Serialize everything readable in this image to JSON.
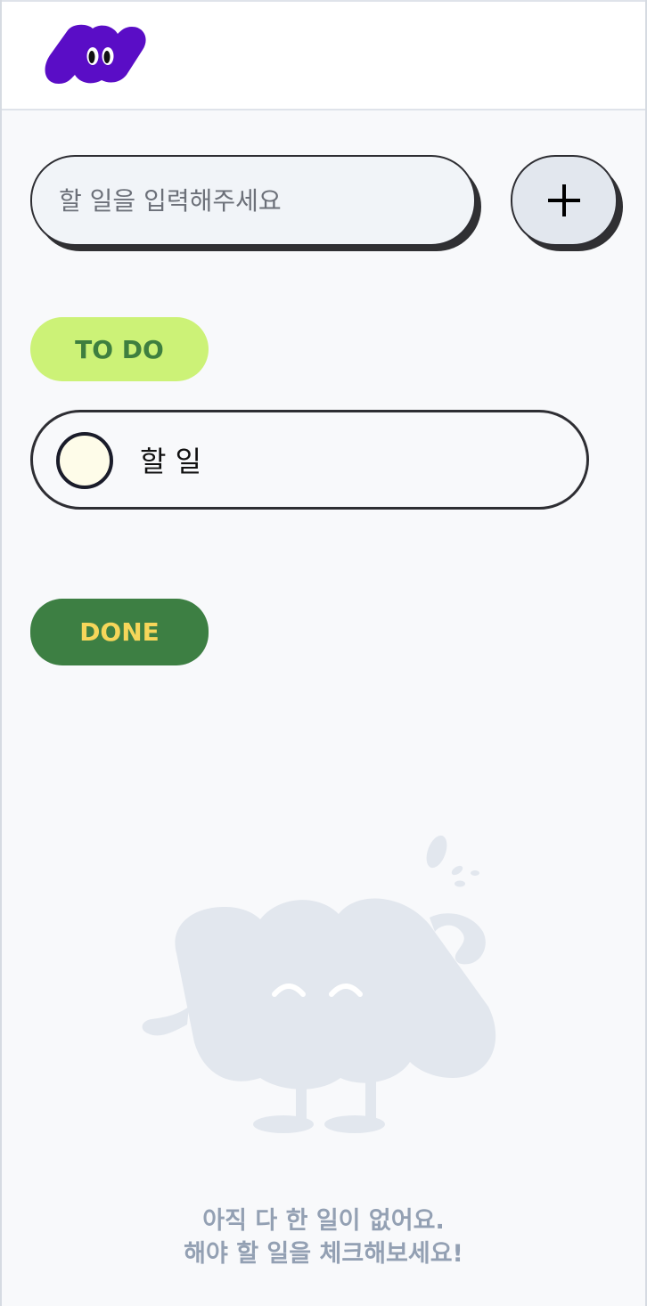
{
  "header": {
    "logo_icon": "purple-blob-logo-icon"
  },
  "input": {
    "placeholder": "할 일을 입력해주세요",
    "value": ""
  },
  "add_button": {
    "label": "+"
  },
  "todo_section": {
    "label": "TO DO",
    "items": [
      {
        "text": "할 일",
        "done": false
      }
    ]
  },
  "done_section": {
    "label": "DONE",
    "empty_line1": "아직 다 한 일이 없어요.",
    "empty_line2": "해야 할 일을 체크해보세요!"
  },
  "colors": {
    "brand_purple": "#5a0dc6",
    "todo_pill_bg": "#ccf277",
    "todo_pill_text": "#3e7f3f",
    "done_pill_bg": "#3d7f43",
    "done_pill_text": "#f6d65a",
    "empty_text": "#93a0b3"
  }
}
